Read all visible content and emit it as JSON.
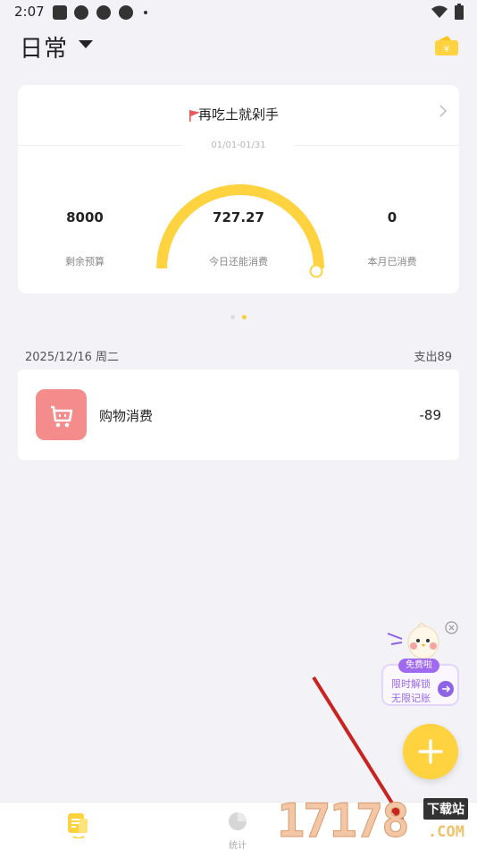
{
  "status_bar": {
    "time": "2:07"
  },
  "header": {
    "ledger_name": "日常"
  },
  "budget_card": {
    "title": "再吃土就剁手",
    "period": "01/01-01/31",
    "remaining_budget": {
      "value": "8000",
      "label": "剩余预算"
    },
    "today_available": {
      "value": "727.27",
      "label": "今日还能消费"
    },
    "month_spent": {
      "value": "0",
      "label": "本月已消费"
    },
    "gauge_fraction": 1.0
  },
  "pager": {
    "count": 2,
    "active": 2
  },
  "day": {
    "date": "2025/12/16 周二",
    "total": "支出89",
    "records": [
      {
        "category": "购物消费",
        "amount": "-89",
        "icon": "shopping-cart-icon"
      }
    ]
  },
  "promo": {
    "badge": "免费啦",
    "line1": "限时解锁",
    "line2": "无限记账"
  },
  "bottom_nav": {
    "tabs": [
      {
        "label": ""
      },
      {
        "label": "统计"
      }
    ]
  },
  "watermark": {
    "digits": "17178",
    "tag": "下载站",
    "domain": ".COM"
  },
  "colors": {
    "accent": "#ffd23f",
    "category": "#f38c8a",
    "promo": "#9a6ae6"
  }
}
